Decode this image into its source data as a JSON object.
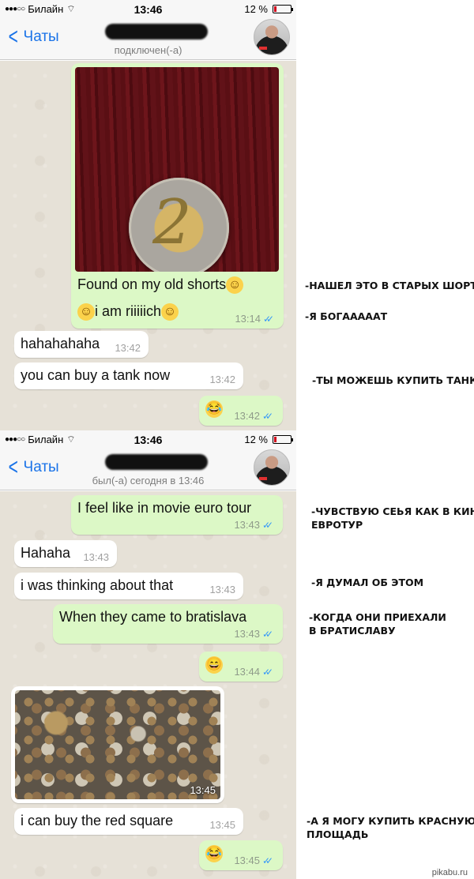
{
  "status": {
    "carrier": "Билайн",
    "time": "13:46",
    "battery": "12 %"
  },
  "nav": {
    "back_label": "Чаты"
  },
  "screen1": {
    "contact_status": "подключен(-а)",
    "messages": [
      {
        "text": "Found on my old shorts",
        "text2": "i am riiiiich",
        "time": "13:14"
      },
      {
        "text": "hahahahaha",
        "time": "13:42"
      },
      {
        "text": "you can buy a tank now",
        "time": "13:42"
      },
      {
        "text": "😂",
        "time": "13:42"
      }
    ]
  },
  "screen2": {
    "contact_status": "был(-а) сегодня в 13:46",
    "messages": [
      {
        "text": "I feel like in movie euro tour",
        "time": "13:43"
      },
      {
        "text": "Hahaha",
        "time": "13:43"
      },
      {
        "text": "i was thinking about that",
        "time": "13:43"
      },
      {
        "text": "When they came to bratislava",
        "time": "13:43"
      },
      {
        "text": "😄",
        "time": "13:44"
      },
      {
        "time": "13:45"
      },
      {
        "text": "i can buy the red square",
        "time": "13:45"
      },
      {
        "text": "😂",
        "time": "13:45"
      }
    ]
  },
  "annotations": [
    "-НАШЕЛ ЭТО В СТАРЫХ ШОРТАХ",
    "-Я БОГАААААТ",
    "-ТЫ МОЖЕШЬ КУПИТЬ ТАНК",
    "-ЧУВСТВУЮ СЕЬЯ КАК В КИНО\nЕВРОТУР",
    "-Я ДУМАЛ ОБ ЭТОМ",
    "-КОГДА ОНИ ПРИЕХАЛИ\nВ БРАТИСЛАВУ",
    "-А Я МОГУ КУПИТЬ КРАСНУЮ\nПЛОЩАДЬ"
  ],
  "emoji": {
    "smile": "😄",
    "joy": "😂"
  },
  "watermark": "pikabu.ru",
  "colors": {
    "outgoing": "#dcf8c6",
    "incoming": "#ffffff",
    "accent": "#1a73e8",
    "ticks": "#3497f9"
  }
}
